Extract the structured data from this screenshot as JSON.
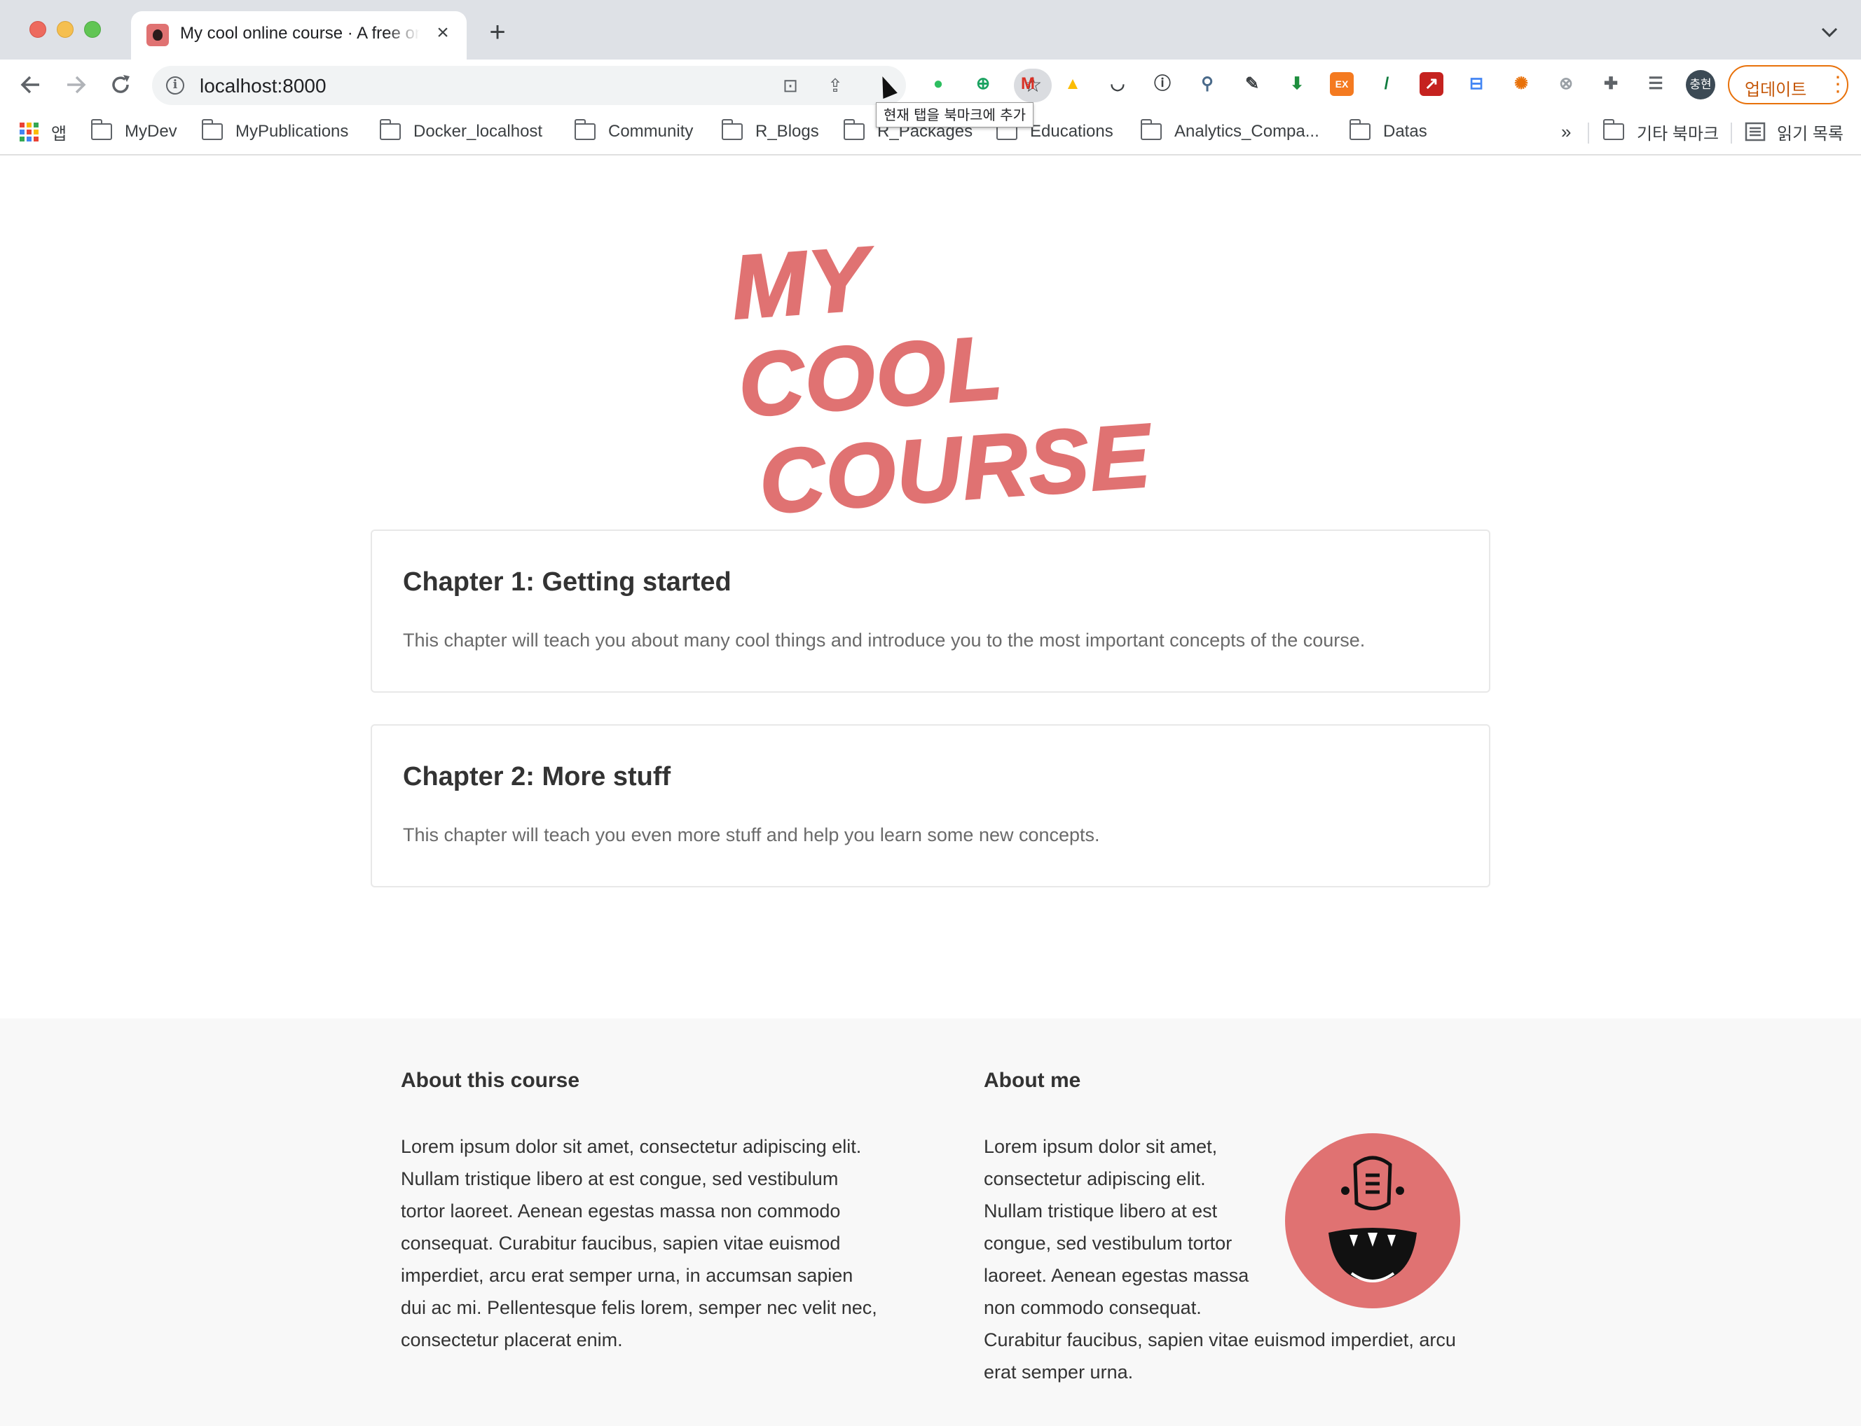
{
  "browser": {
    "tab_title": "My cool online course · A free online course",
    "url": "localhost:8000",
    "tooltip": "현재 탭을 북마크에 추가",
    "profile_initials": "충현",
    "update_label": "업데이트"
  },
  "bookmarks": {
    "apps_label": "앱",
    "folders": [
      "MyDev",
      "MyPublications",
      "Docker_localhost",
      "Community",
      "R_Blogs",
      "R_Packages",
      "Educations",
      "Analytics_Compa...",
      "Datas"
    ],
    "overflow": "»",
    "other_bookmarks": "기타 북마크",
    "reading_list": "읽기 목록"
  },
  "hero": {
    "title_line1": "MY COOL",
    "title_line2": "COURSE"
  },
  "chapters": [
    {
      "title": "Chapter 1: Getting started",
      "description": "This chapter will teach you about many cool things and introduce you to the most important concepts of the course."
    },
    {
      "title": "Chapter 2: More stuff",
      "description": "This chapter will teach you even more stuff and help you learn some new concepts."
    }
  ],
  "footer": {
    "about_course_title": "About this course",
    "about_course_text": "Lorem ipsum dolor sit amet, consectetur adipiscing elit. Nullam tristique libero at est congue, sed vestibulum tortor laoreet. Aenean egestas massa non commodo consequat. Curabitur faucibus, sapien vitae euismod imperdiet, arcu erat semper urna, in accumsan sapien dui ac mi. Pellentesque felis lorem, semper nec velit nec, consectetur placerat enim.",
    "about_me_title": "About me",
    "about_me_text_wrapped": "Lorem ipsum dolor sit amet, consectetur adipiscing elit. Nullam tristique libero at est congue, sed vestibulum tortor laoreet. Aenean egestas massa non commodo consequat.",
    "about_me_text_full": "Curabitur faucibus, sapien vitae euismod imperdiet, arcu erat semper urna."
  },
  "colors": {
    "accent": "#e07272",
    "footer_bg": "#f8f8f8",
    "update_orange": "#e8710a"
  }
}
